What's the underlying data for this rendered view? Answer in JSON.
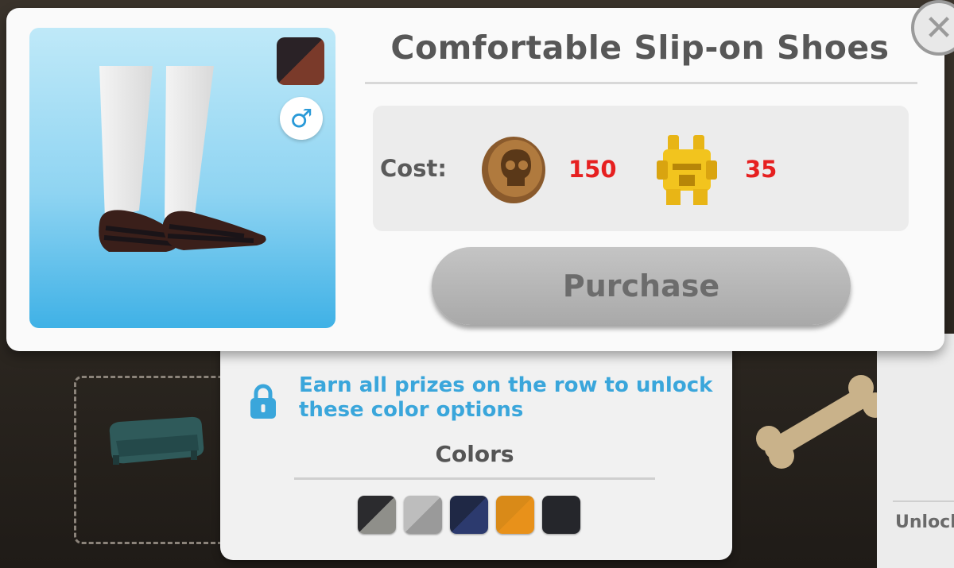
{
  "item": {
    "title": "Comfortable Slip-on Shoes",
    "gender_icon": "male-symbol-icon",
    "gender_glyph": "♂",
    "selected_color": [
      "#2a2226",
      "#7a3a2a"
    ]
  },
  "cost": {
    "label": "Cost:",
    "items": [
      {
        "currency_icon": "skull-coin-icon",
        "amount": "150"
      },
      {
        "currency_icon": "gold-totem-icon",
        "amount": "35"
      }
    ]
  },
  "purchase_label": "Purchase",
  "close_glyph": "✕",
  "unlock_message": "Earn all prizes on the row to unlock these color options",
  "colors_title": "Colors",
  "color_swatches": [
    {
      "name": "black-gray",
      "colors": [
        "#2b2b2e",
        "#8f8f8a"
      ]
    },
    {
      "name": "light-gray",
      "colors": [
        "#bdbdbd",
        "#9a9a9a"
      ]
    },
    {
      "name": "navy",
      "colors": [
        "#1f2845",
        "#2c3a6e"
      ]
    },
    {
      "name": "orange",
      "colors": [
        "#d98a18",
        "#e8911a"
      ]
    },
    {
      "name": "charcoal",
      "colors": [
        "#25262b",
        "#25262b"
      ]
    }
  ],
  "background": {
    "partial_label": "Unlock"
  },
  "colors": {
    "accent_blue": "#3aa6db",
    "cost_red": "#e62020",
    "button_gray": "#b5b5b5"
  }
}
